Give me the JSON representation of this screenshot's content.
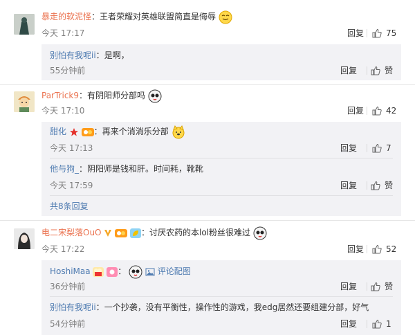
{
  "comments": [
    {
      "user": "暴走的软泥怪",
      "text": "王者荣耀对英雄联盟简直是侮辱",
      "time": "今天 17:17",
      "reply": "回复",
      "likes": "75",
      "replies": [
        {
          "user": "别怕有我呢ii",
          "text": "是啊，",
          "time": "55分钟前",
          "reply": "回复",
          "likes": "赞"
        }
      ]
    },
    {
      "user": "ParTrick9",
      "text": "有阴阳师分部吗",
      "time": "今天 17:10",
      "reply": "回复",
      "likes": "42",
      "replies": [
        {
          "user": "甜化",
          "text": "再来个消消乐分部",
          "time": "今天 17:13",
          "reply": "回复",
          "likes": "7"
        },
        {
          "user": "他与狗_",
          "text": "阴阳师是钱和肝。时间耗，靴靴",
          "time": "今天 17:59",
          "reply": "回复",
          "likes": "赞"
        }
      ],
      "more": "共8条回复"
    },
    {
      "user": "电二宋梨落OuO",
      "text": "讨厌农药的本lol粉丝很难过",
      "time": "今天 17:22",
      "reply": "回复",
      "likes": "52",
      "replies": [
        {
          "user": "HoshiMaa",
          "text": "",
          "time": "36分钟前",
          "reply": "回复",
          "likes": "赞",
          "pic_comment": "评论配图"
        },
        {
          "user": "别怕有我呢ii",
          "text": "一个抄袭，没有平衡性，操作性的游戏，我edg居然还要组建分部，好气",
          "time": "54分钟前",
          "reply": "回复",
          "likes": "1"
        }
      ]
    }
  ],
  "colors": {
    "link": "#eb7350",
    "accent_blue": "#4d7ab0",
    "sub_bg": "#f2f2f5",
    "muted": "#808080"
  },
  "icons": [
    "thumb-up-icon",
    "smile-emoji-icon",
    "image-icon",
    "vip-badge-icon"
  ]
}
